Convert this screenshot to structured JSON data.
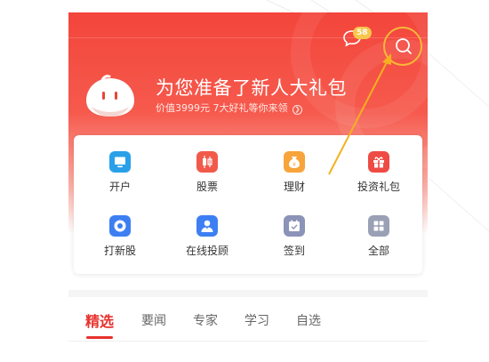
{
  "header": {
    "message_badge_count": "58",
    "icons": {
      "message": "chat-bubble-icon",
      "search": "search-icon"
    }
  },
  "promo": {
    "title": "为您准备了新人大礼包",
    "subtitle": "价值3999元 7大好礼等你来领",
    "subtitle_icon": "chevron-right-circle-icon"
  },
  "grid": {
    "items": [
      {
        "label": "开户",
        "icon": "monitor-icon",
        "color": "#2aa0e8"
      },
      {
        "label": "股票",
        "icon": "candlestick-icon",
        "color": "#f15a4a"
      },
      {
        "label": "理财",
        "icon": "money-bag-icon",
        "color": "#f7a43b"
      },
      {
        "label": "投资礼包",
        "icon": "gift-icon",
        "color": "#ee4b44"
      },
      {
        "label": "打新股",
        "icon": "new-stock-icon",
        "color": "#3d7ff2"
      },
      {
        "label": "在线投顾",
        "icon": "advisor-icon",
        "color": "#3d7ff2"
      },
      {
        "label": "签到",
        "icon": "calendar-check-icon",
        "color": "#8b93b8"
      },
      {
        "label": "全部",
        "icon": "grid-icon",
        "color": "#9aa0b5"
      }
    ]
  },
  "tabs": [
    {
      "label": "精选",
      "active": true
    },
    {
      "label": "要闻",
      "active": false
    },
    {
      "label": "专家",
      "active": false
    },
    {
      "label": "学习",
      "active": false
    },
    {
      "label": "自选",
      "active": false
    }
  ],
  "annotation": {
    "arrow_color": "#f4b020"
  }
}
